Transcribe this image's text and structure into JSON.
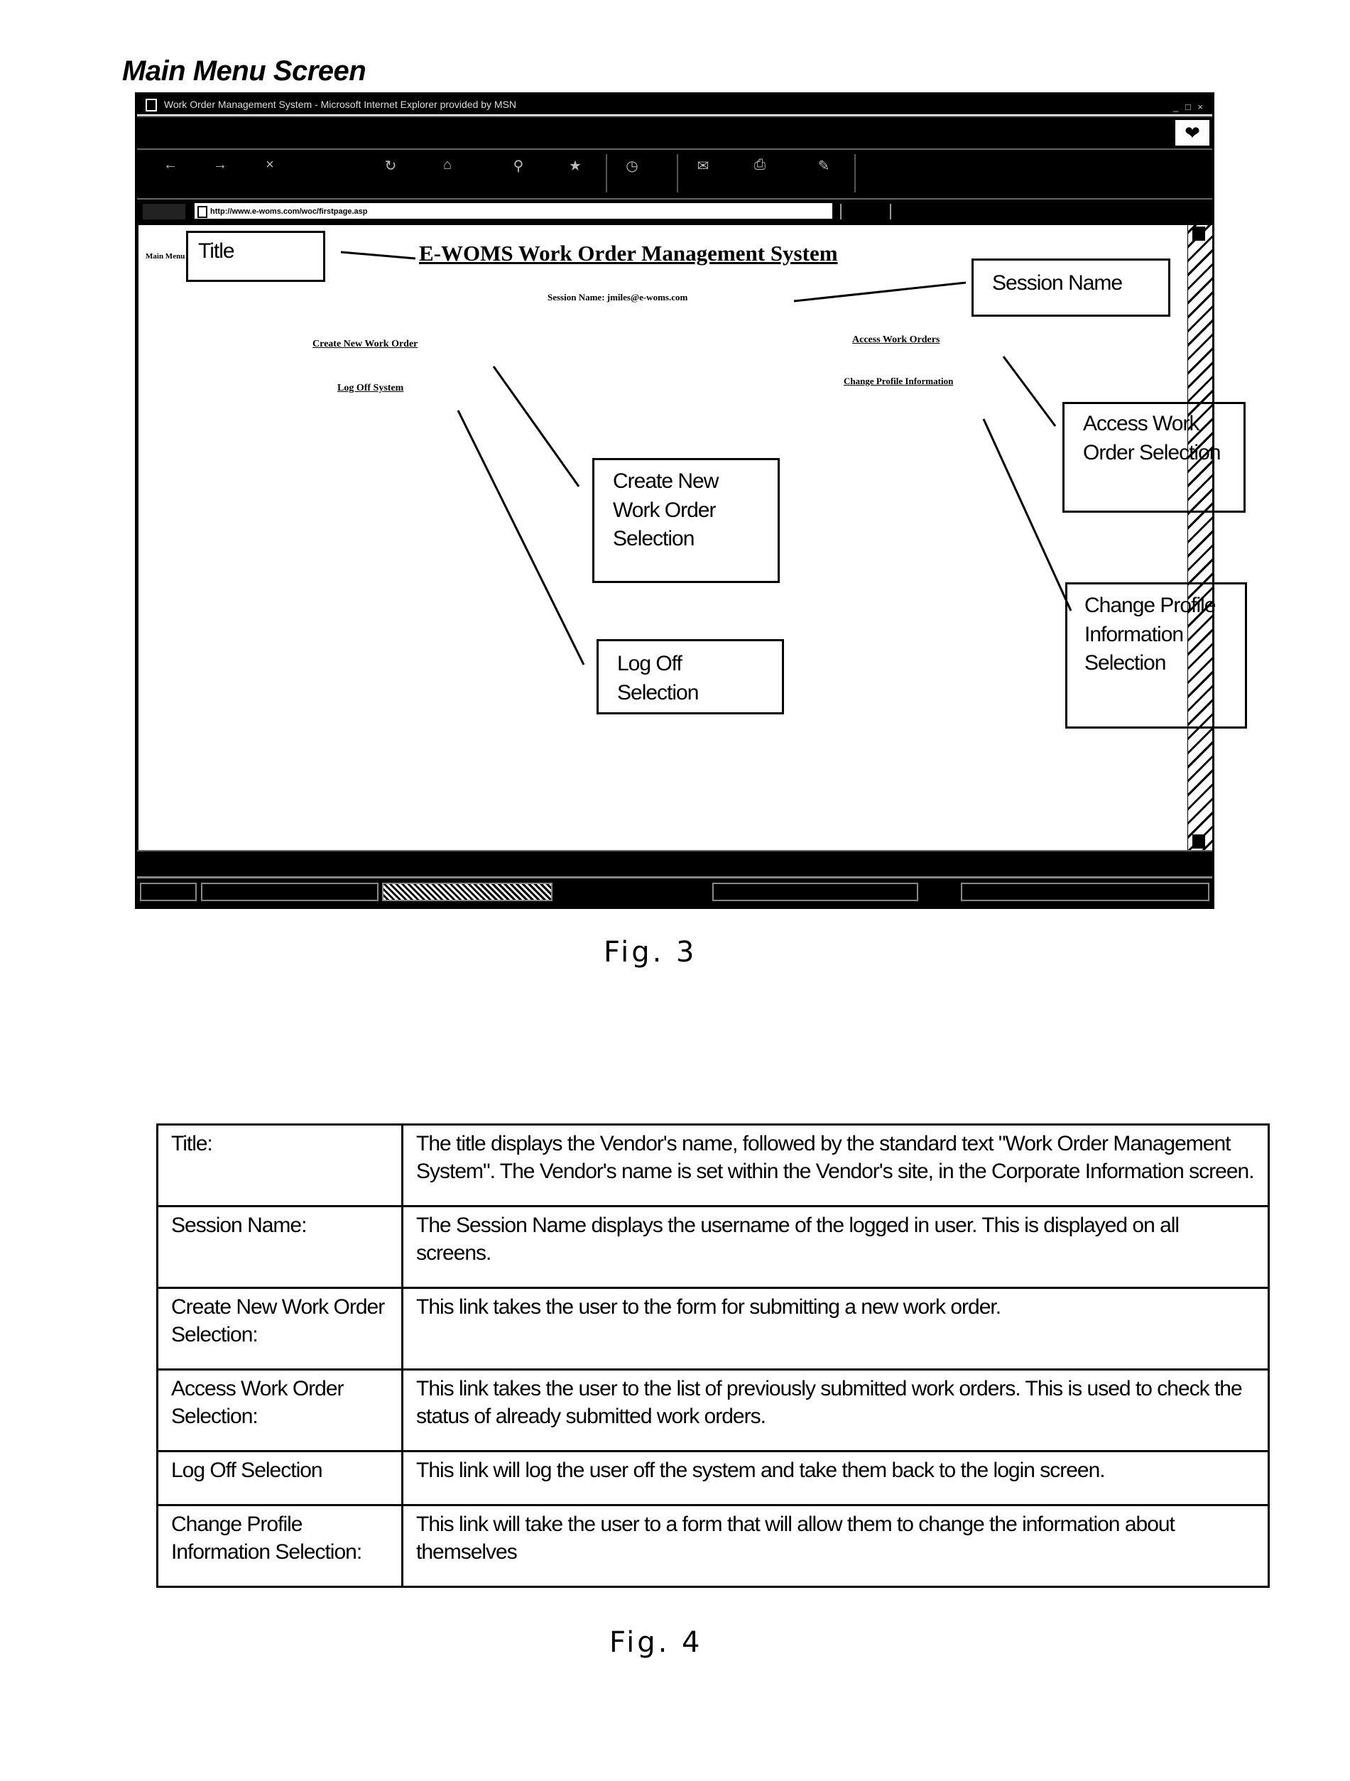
{
  "page": {
    "heading": "Main Menu Screen",
    "fig3_label": "Fig. 3",
    "fig4_label": "Fig. 4"
  },
  "browser": {
    "window_title": "Work Order Management System - Microsoft Internet Explorer provided by MSN",
    "window_controls": "_ □ ×",
    "address_url": "http://www.e-woms.com/woc/firstpage.asp",
    "brand_logo_icon": "msn-butterfly-icon",
    "toolbar_icons": [
      "back-icon",
      "forward-icon",
      "stop-icon",
      "refresh-icon",
      "home-icon",
      "search-icon",
      "favorites-icon",
      "history-icon",
      "mail-icon",
      "print-icon",
      "edit-icon"
    ]
  },
  "app": {
    "left_nav_label": "Main Menu",
    "title": "E-WOMS  Work Order Management System",
    "session_line": "Session Name: jmiles@e-woms.com",
    "links": {
      "create_new": "Create New Work Order",
      "log_off": "Log Off System",
      "access_orders": "Access Work Orders",
      "change_profile": "Change Profile Information"
    }
  },
  "callouts": {
    "title": "Title",
    "session_name": "Session Name",
    "access": "Access Work Order Selection",
    "create": "Create New Work Order Selection",
    "change_profile": "Change Profile Information Selection",
    "log_off": "Log Off Selection"
  },
  "table": {
    "rows": [
      {
        "term": "Title:",
        "description": "The title displays the Vendor's name, followed by the standard text \"Work Order Management System\".  The Vendor's name is set within the Vendor's site, in the Corporate Information screen."
      },
      {
        "term": "Session Name:",
        "description": "The Session Name displays the username of the logged in user.  This is displayed on all screens."
      },
      {
        "term": "Create New Work Order Selection:",
        "description": "This link takes the user to the form for submitting a new work order."
      },
      {
        "term": "Access Work Order Selection:",
        "description": "This link takes the user to the list of previously submitted work orders.  This is used to check the status of already submitted work orders."
      },
      {
        "term": "Log Off Selection",
        "description": "This link will log the user off the system and take them back to the login screen."
      },
      {
        "term": "Change Profile Information Selection:",
        "description": "This link will take the user to a form that will allow them to change the information about themselves"
      }
    ]
  }
}
